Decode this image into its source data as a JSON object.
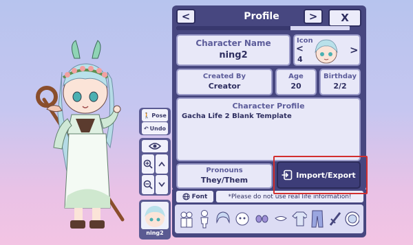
{
  "header": {
    "title": "Profile",
    "prev_label": "<",
    "next_label": ">",
    "close_label": "X",
    "page_progress": 0.66
  },
  "character_name": {
    "label": "Character Name",
    "value": "ning2"
  },
  "icon_selector": {
    "label": "Icon",
    "number": "4",
    "prev_label": "<",
    "next_label": ">"
  },
  "created_by": {
    "label": "Created By",
    "value": "Creator"
  },
  "age": {
    "label": "Age",
    "value": "20"
  },
  "birthday": {
    "label": "Birthday",
    "value": "2/2"
  },
  "character_profile": {
    "label": "Character Profile",
    "value": "Gacha Life 2 Blank Template"
  },
  "pronouns": {
    "label": "Pronouns",
    "value": "They/Them"
  },
  "import_export": {
    "label": "Import/Export"
  },
  "font_button": {
    "label": "Font"
  },
  "notice": {
    "text": "*Please do not use real life information!"
  },
  "tools": {
    "pose_label": "Pose",
    "undo_label": "Undo"
  },
  "selected_character": {
    "label": "ning2"
  },
  "colors": {
    "panel": "#474780",
    "card": "#e8e8f8",
    "text": "#2e2e60",
    "highlight": "#d22e2e"
  },
  "category_icons": [
    "group-icon",
    "body-icon",
    "hair-icon",
    "face-icon",
    "eyes-icon",
    "mouth-icon",
    "top-icon",
    "bottom-icon",
    "sword-icon",
    "profile-icon"
  ]
}
